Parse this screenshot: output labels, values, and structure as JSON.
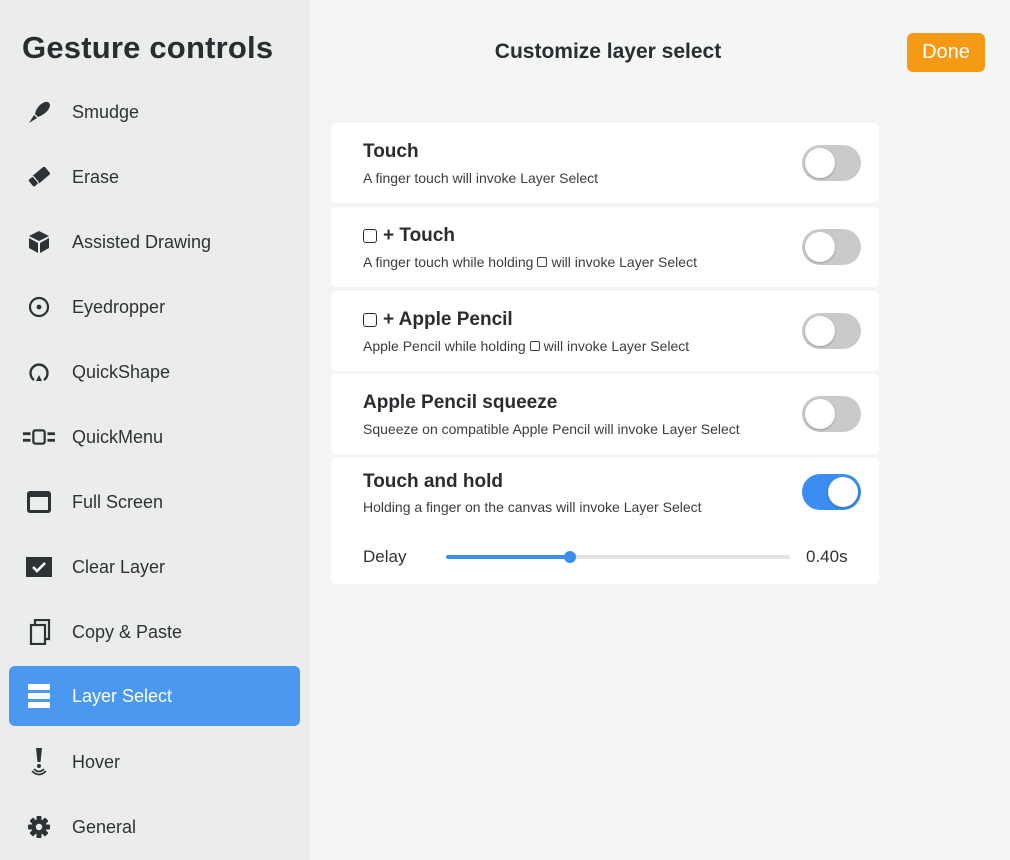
{
  "sidebar": {
    "title": "Gesture controls",
    "items": [
      {
        "label": "Smudge",
        "icon": "smudge-icon"
      },
      {
        "label": "Erase",
        "icon": "eraser-icon"
      },
      {
        "label": "Assisted Drawing",
        "icon": "cube-icon"
      },
      {
        "label": "Eyedropper",
        "icon": "eyedropper-icon"
      },
      {
        "label": "QuickShape",
        "icon": "quickshape-icon"
      },
      {
        "label": "QuickMenu",
        "icon": "quickmenu-icon"
      },
      {
        "label": "Full Screen",
        "icon": "fullscreen-icon"
      },
      {
        "label": "Clear Layer",
        "icon": "clear-layer-icon"
      },
      {
        "label": "Copy & Paste",
        "icon": "copy-paste-icon"
      },
      {
        "label": "Layer Select",
        "icon": "layer-select-icon",
        "active": true
      },
      {
        "label": "Hover",
        "icon": "hover-icon"
      },
      {
        "label": "General",
        "icon": "gear-icon"
      }
    ]
  },
  "main": {
    "title": "Customize layer select",
    "done_label": "Done",
    "options": [
      {
        "title": "Touch",
        "subtitle": "A finger touch will invoke Layer Select",
        "enabled": false
      },
      {
        "title": "+ Touch",
        "subtitle_before": "A finger touch while holding",
        "subtitle_after": "will invoke Layer Select",
        "enabled": false
      },
      {
        "title": "+ Apple Pencil",
        "subtitle_before": "Apple Pencil while holding",
        "subtitle_after": "will invoke Layer Select",
        "enabled": false
      },
      {
        "title": "Apple Pencil squeeze",
        "subtitle": "Squeeze on compatible Apple Pencil will invoke Layer Select",
        "enabled": false
      },
      {
        "title": "Touch and hold",
        "subtitle": "Holding a finger on the canvas will invoke Layer Select",
        "enabled": true
      }
    ],
    "delay": {
      "label": "Delay",
      "value_text": "0.40s",
      "fraction": 0.36
    }
  },
  "colors": {
    "accent": "#3b8def",
    "done": "#f59a14",
    "active_item": "#4b98f0"
  }
}
